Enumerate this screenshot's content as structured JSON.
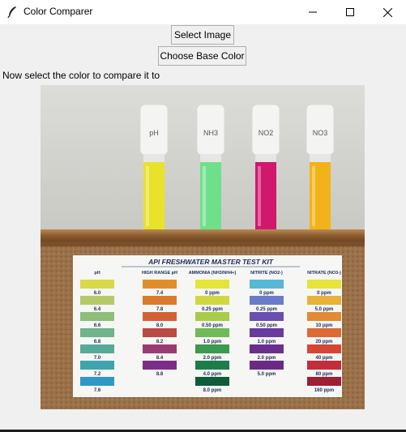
{
  "window": {
    "title": "Color Comparer",
    "controls": [
      "minimize-icon",
      "maximize-icon",
      "close-icon"
    ]
  },
  "toolbar": {
    "select_image_label": "Select Image",
    "choose_base_color_label": "Choose Base Color"
  },
  "status": {
    "message": "Now select the color to compare it to"
  },
  "photo": {
    "tubes": [
      {
        "label": "pH",
        "color": "#e8e32a"
      },
      {
        "label": "NH3",
        "color": "#6fe08a"
      },
      {
        "label": "NO2",
        "color": "#d0186e"
      },
      {
        "label": "NO3",
        "color": "#f2b31a"
      }
    ],
    "card": {
      "title": "API FRESHWATER MASTER TEST KIT",
      "columns": [
        {
          "header": "pH",
          "swatches": [
            {
              "label": "6.0",
              "color": "#d9d84a"
            },
            {
              "label": "6.4",
              "color": "#b6c96a"
            },
            {
              "label": "6.6",
              "color": "#8dbf7a"
            },
            {
              "label": "6.8",
              "color": "#6fb48a"
            },
            {
              "label": "7.0",
              "color": "#58aa98"
            },
            {
              "label": "7.2",
              "color": "#3ea4ae"
            },
            {
              "label": "7.6",
              "color": "#2f98c6"
            }
          ]
        },
        {
          "header": "HIGH RANGE pH",
          "swatches": [
            {
              "label": "7.4",
              "color": "#e08e2c"
            },
            {
              "label": "7.8",
              "color": "#db7a2c"
            },
            {
              "label": "8.0",
              "color": "#d26236"
            },
            {
              "label": "8.2",
              "color": "#bc4a44"
            },
            {
              "label": "8.4",
              "color": "#9b3a72"
            },
            {
              "label": "8.8",
              "color": "#7e2c8a"
            }
          ]
        },
        {
          "header": "AMMONIA (NH3/NH4+)",
          "swatches": [
            {
              "label": "0 ppm",
              "color": "#e6e33a"
            },
            {
              "label": "0.25 ppm",
              "color": "#cfd93f"
            },
            {
              "label": "0.50 ppm",
              "color": "#a7cc4a"
            },
            {
              "label": "1.0 ppm",
              "color": "#6fbb55"
            },
            {
              "label": "2.0 ppm",
              "color": "#3b9a4f"
            },
            {
              "label": "4.0 ppm",
              "color": "#1d7d4a"
            },
            {
              "label": "8.0 ppm",
              "color": "#0e5c3c"
            }
          ]
        },
        {
          "header": "NITRITE (NO2-)",
          "swatches": [
            {
              "label": "0 ppm",
              "color": "#56b8d6"
            },
            {
              "label": "0.25 ppm",
              "color": "#6a7cc7"
            },
            {
              "label": "0.50 ppm",
              "color": "#6a4fb0"
            },
            {
              "label": "1.0 ppm",
              "color": "#6a3a9e"
            },
            {
              "label": "2.0 ppm",
              "color": "#6a2f8e"
            },
            {
              "label": "5.0 ppm",
              "color": "#6a2a84"
            }
          ]
        },
        {
          "header": "NITRATE (NO3-)",
          "swatches": [
            {
              "label": "0 ppm",
              "color": "#e6e33a"
            },
            {
              "label": "5.0 ppm",
              "color": "#e8b238"
            },
            {
              "label": "10 ppm",
              "color": "#e28b34"
            },
            {
              "label": "20 ppm",
              "color": "#dc6a34"
            },
            {
              "label": "40 ppm",
              "color": "#d64634"
            },
            {
              "label": "80 ppm",
              "color": "#c12d3a"
            },
            {
              "label": "160 ppm",
              "color": "#9d1f36"
            }
          ]
        }
      ]
    }
  }
}
